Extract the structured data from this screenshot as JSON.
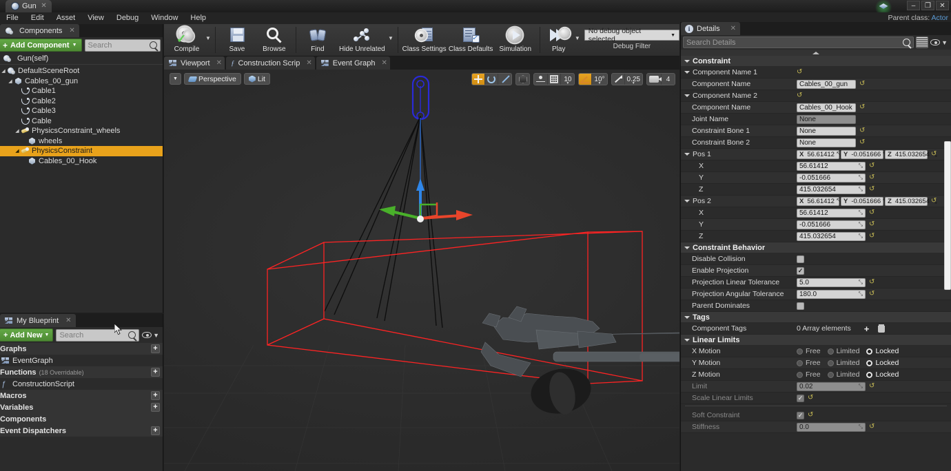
{
  "window": {
    "tab_title": "Gun",
    "minimize": "–",
    "maximize": "❐",
    "close": "✕",
    "parent_class_label": "Parent class:",
    "parent_class_value": "Actor"
  },
  "menu": [
    "File",
    "Edit",
    "Asset",
    "View",
    "Debug",
    "Window",
    "Help"
  ],
  "components_panel": {
    "tab_label": "Components",
    "add_button": "Add Component",
    "search_placeholder": "Search",
    "self_row": "Gun(self)",
    "tree": [
      {
        "label": "DefaultSceneRoot",
        "depth": 0,
        "icon": "scene-root-icon",
        "arrow": true,
        "selected": false
      },
      {
        "label": "Cables_00_gun",
        "depth": 1,
        "icon": "static-mesh-icon",
        "arrow": true,
        "selected": false
      },
      {
        "label": "Cable1",
        "depth": 2,
        "icon": "cable-icon",
        "arrow": false,
        "selected": false
      },
      {
        "label": "Cable2",
        "depth": 2,
        "icon": "cable-icon",
        "arrow": false,
        "selected": false
      },
      {
        "label": "Cable3",
        "depth": 2,
        "icon": "cable-icon",
        "arrow": false,
        "selected": false
      },
      {
        "label": "Cable",
        "depth": 2,
        "icon": "cable-icon",
        "arrow": false,
        "selected": false
      },
      {
        "label": "PhysicsConstraint_wheels",
        "depth": 2,
        "icon": "physics-constraint-icon",
        "arrow": true,
        "selected": false
      },
      {
        "label": "wheels",
        "depth": 3,
        "icon": "static-mesh-icon",
        "arrow": false,
        "selected": false
      },
      {
        "label": "PhysicsConstraint",
        "depth": 2,
        "icon": "physics-constraint-icon",
        "arrow": true,
        "selected": true
      },
      {
        "label": "Cables_00_Hook",
        "depth": 3,
        "icon": "static-mesh-icon",
        "arrow": false,
        "selected": false
      }
    ]
  },
  "my_blueprint_panel": {
    "tab_label": "My Blueprint",
    "add_button": "Add New",
    "search_placeholder": "Search",
    "sections": [
      {
        "kind": "head",
        "label": "Graphs",
        "note": "",
        "plus": true
      },
      {
        "kind": "item",
        "label": "EventGraph",
        "icon": "event-graph-icon"
      },
      {
        "kind": "head",
        "label": "Functions",
        "note": "(18 Overridable)",
        "plus": true
      },
      {
        "kind": "item",
        "label": "ConstructionScript",
        "icon": "function-icon"
      },
      {
        "kind": "head",
        "label": "Macros",
        "note": "",
        "plus": true
      },
      {
        "kind": "head",
        "label": "Variables",
        "note": "",
        "plus": true
      },
      {
        "kind": "head",
        "label": "Components",
        "note": "",
        "plus": false
      },
      {
        "kind": "head",
        "label": "Event Dispatchers",
        "note": "",
        "plus": true
      }
    ]
  },
  "toolbar": {
    "items": [
      {
        "label": "Compile",
        "icon": "compile-gear-check-icon",
        "caret": true
      },
      {
        "label": "Save",
        "icon": "save-floppy-icon",
        "caret": false
      },
      {
        "label": "Browse",
        "icon": "browse-magnifier-icon",
        "caret": false
      },
      {
        "label": "Find",
        "icon": "find-binoculars-icon",
        "caret": false
      },
      {
        "label": "Hide Unrelated",
        "icon": "hide-unrelated-nodes-icon",
        "caret": true
      },
      {
        "label": "Class Settings",
        "icon": "class-settings-icon",
        "caret": false
      },
      {
        "label": "Class Defaults",
        "icon": "class-defaults-icon",
        "caret": false
      },
      {
        "label": "Simulation",
        "icon": "simulation-icon",
        "caret": false
      },
      {
        "label": "Play",
        "icon": "play-icon",
        "caret": true
      }
    ],
    "debug_object": "No debug object selected",
    "debug_filter_label": "Debug Filter"
  },
  "viewport": {
    "tabs": [
      {
        "label": "Viewport",
        "icon": "viewport-icon",
        "active": true
      },
      {
        "label": "Construction Scrip",
        "icon": "construction-script-icon",
        "active": false
      },
      {
        "label": "Event Graph",
        "icon": "event-graph-icon",
        "active": false
      }
    ],
    "view_mode_caret": "▼",
    "camera_mode": "Perspective",
    "lighting_mode": "Lit",
    "controls": {
      "translate_icon": "translate-gizmo-icon",
      "rotate_icon": "rotate-gizmo-icon",
      "scale_icon": "scale-gizmo-icon",
      "coord_space_icon": "world-space-cube-icon",
      "surface_snap_icon": "surface-snap-icon",
      "grid_snap_icon": "grid-snap-icon",
      "grid_snap_value": "10",
      "angle_snap_icon": "angle-snap-icon",
      "angle_snap_value": "10°",
      "scale_snap_icon": "scale-snap-icon",
      "scale_snap_value": "0.25",
      "camera_speed_icon": "camera-speed-icon",
      "camera_speed_value": "4"
    }
  },
  "details": {
    "tab_label": "Details",
    "search_placeholder": "Search Details",
    "categories": [
      {
        "name": "Constraint",
        "rows": [
          {
            "label": "Component Name 1",
            "indent": 1,
            "expander": true,
            "type": "revert-only"
          },
          {
            "label": "Component Name",
            "indent": 2,
            "expander": false,
            "type": "text",
            "value": "Cables_00_gun"
          },
          {
            "label": "Component Name 2",
            "indent": 1,
            "expander": true,
            "type": "revert-only"
          },
          {
            "label": "Component Name",
            "indent": 2,
            "expander": false,
            "type": "text",
            "value": "Cables_00_Hook"
          },
          {
            "label": "Joint Name",
            "indent": 2,
            "expander": false,
            "type": "text-readonly",
            "value": "None"
          },
          {
            "label": "Constraint Bone 1",
            "indent": 2,
            "expander": false,
            "type": "text",
            "value": "None"
          },
          {
            "label": "Constraint Bone 2",
            "indent": 2,
            "expander": false,
            "type": "text",
            "value": "None"
          },
          {
            "label": "Pos 1",
            "indent": 1,
            "expander": true,
            "type": "vector",
            "x": "56.61412",
            "y": "-0.051666",
            "z": "415.032654"
          },
          {
            "label": "X",
            "indent": 3,
            "expander": false,
            "type": "number",
            "value": "56.61412"
          },
          {
            "label": "Y",
            "indent": 3,
            "expander": false,
            "type": "number",
            "value": "-0.051666"
          },
          {
            "label": "Z",
            "indent": 3,
            "expander": false,
            "type": "number",
            "value": "415.032654"
          },
          {
            "label": "Pos 2",
            "indent": 1,
            "expander": true,
            "type": "vector",
            "x": "56.61412",
            "y": "-0.051666",
            "z": "415.032654"
          },
          {
            "label": "X",
            "indent": 3,
            "expander": false,
            "type": "number",
            "value": "56.61412"
          },
          {
            "label": "Y",
            "indent": 3,
            "expander": false,
            "type": "number",
            "value": "-0.051666"
          },
          {
            "label": "Z",
            "indent": 3,
            "expander": false,
            "type": "number",
            "value": "415.032654"
          }
        ]
      },
      {
        "name": "Constraint Behavior",
        "rows": [
          {
            "label": "Disable Collision",
            "indent": 2,
            "expander": false,
            "type": "checkbox",
            "checked": false
          },
          {
            "label": "Enable Projection",
            "indent": 2,
            "expander": false,
            "type": "checkbox",
            "checked": true
          },
          {
            "label": "Projection Linear Tolerance",
            "indent": 2,
            "expander": false,
            "type": "number",
            "value": "5.0"
          },
          {
            "label": "Projection Angular Tolerance",
            "indent": 2,
            "expander": false,
            "type": "number",
            "value": "180.0"
          },
          {
            "label": "Parent Dominates",
            "indent": 2,
            "expander": false,
            "type": "checkbox",
            "checked": false
          }
        ]
      },
      {
        "name": "Tags",
        "rows": [
          {
            "label": "Component Tags",
            "indent": 2,
            "expander": false,
            "type": "array",
            "value": "0 Array elements"
          }
        ]
      },
      {
        "name": "Linear Limits",
        "rows": [
          {
            "label": "X Motion",
            "indent": 2,
            "expander": false,
            "type": "radio",
            "options": [
              "Free",
              "Limited",
              "Locked"
            ],
            "selected": "Locked"
          },
          {
            "label": "Y Motion",
            "indent": 2,
            "expander": false,
            "type": "radio",
            "options": [
              "Free",
              "Limited",
              "Locked"
            ],
            "selected": "Locked"
          },
          {
            "label": "Z Motion",
            "indent": 2,
            "expander": false,
            "type": "radio",
            "options": [
              "Free",
              "Limited",
              "Locked"
            ],
            "selected": "Locked"
          },
          {
            "label": "Limit",
            "indent": 2,
            "expander": false,
            "type": "number",
            "value": "0.02",
            "disabled": true
          },
          {
            "label": "Scale Linear Limits",
            "indent": 2,
            "expander": false,
            "type": "checkbox",
            "checked": true,
            "disabled": true
          },
          {
            "label": "",
            "indent": 0,
            "expander": false,
            "type": "separator"
          },
          {
            "label": "Soft Constraint",
            "indent": 2,
            "expander": false,
            "type": "checkbox",
            "checked": true,
            "disabled": true
          },
          {
            "label": "Stiffness",
            "indent": 2,
            "expander": false,
            "type": "number",
            "value": "0.0",
            "disabled": true
          }
        ]
      }
    ]
  },
  "colors": {
    "selection_orange": "#e8a21b",
    "add_button_green": "#4d8a33",
    "bounds_red": "#ff2020",
    "axis_x_red": "#e8452b",
    "axis_y_green": "#49b02a",
    "axis_z_blue": "#2f86e8",
    "constraint_blue": "#2a2ad0",
    "panel_bg": "#2b2b2b",
    "link_blue": "#5b9bd5"
  }
}
